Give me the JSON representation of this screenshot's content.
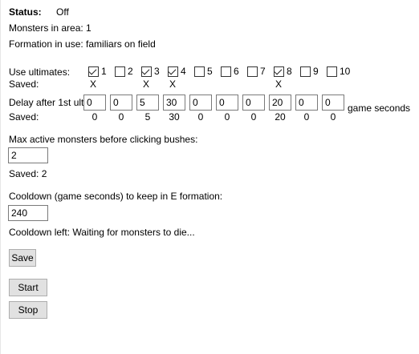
{
  "status": {
    "label": "Status:",
    "value": "Off"
  },
  "monsters_in_area": "Monsters in area: 1",
  "formation": "Formation in use: familiars on field",
  "ultimates": {
    "label": "Use ultimates:",
    "saved_label": "Saved:",
    "items": [
      {
        "num": "1",
        "checked": true,
        "saved": "X"
      },
      {
        "num": "2",
        "checked": false,
        "saved": ""
      },
      {
        "num": "3",
        "checked": true,
        "saved": "X"
      },
      {
        "num": "4",
        "checked": true,
        "saved": "X"
      },
      {
        "num": "5",
        "checked": false,
        "saved": ""
      },
      {
        "num": "6",
        "checked": false,
        "saved": ""
      },
      {
        "num": "7",
        "checked": false,
        "saved": ""
      },
      {
        "num": "8",
        "checked": true,
        "saved": "X"
      },
      {
        "num": "9",
        "checked": false,
        "saved": ""
      },
      {
        "num": "10",
        "checked": false,
        "saved": ""
      }
    ]
  },
  "delay": {
    "label": "Delay after 1st ult:",
    "saved_label": "Saved:",
    "unit": "game seconds",
    "values": [
      "0",
      "0",
      "5",
      "30",
      "0",
      "0",
      "0",
      "20",
      "0",
      "0"
    ],
    "saved": [
      "0",
      "0",
      "5",
      "30",
      "0",
      "0",
      "0",
      "20",
      "0",
      "0"
    ]
  },
  "max_monsters": {
    "label": "Max active monsters before clicking bushes:",
    "value": "2",
    "saved": "Saved: 2"
  },
  "cooldown": {
    "label": "Cooldown (game seconds) to keep in E formation:",
    "value": "240",
    "left": "Cooldown left: Waiting for monsters to die..."
  },
  "buttons": {
    "save": "Save",
    "start": "Start",
    "stop": "Stop"
  }
}
